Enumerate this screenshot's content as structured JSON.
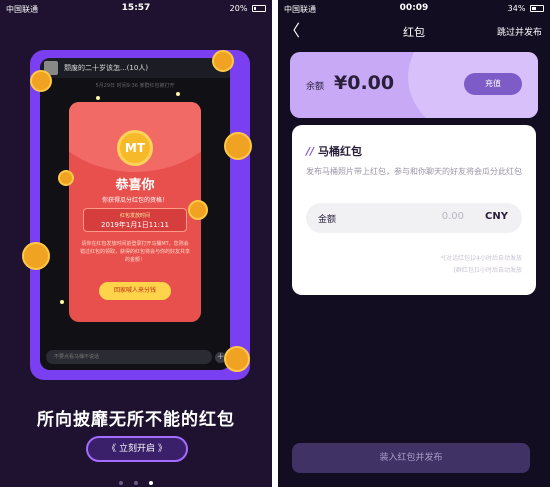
{
  "left": {
    "statusbar": {
      "carrier": "中国联通",
      "time": "15:57",
      "battery": "20%"
    },
    "chat": {
      "title": "颓废的二十岁该怎...(10人)",
      "subtitle": "5月29日 时间9:36 某群红包被打开"
    },
    "redpacket": {
      "coin_text": "MT",
      "title": "恭喜你",
      "subtitle": "你获得瓜分红包的资格！",
      "time_label": "红包发放时间",
      "time_value": "2019年1月1日11:11",
      "description": "请你在红包发放时间前登录打开马桶MT，您则会错过红包的领取，获得的红包将会与你的好友共享的金额！",
      "button": "回家喊人来分钱"
    },
    "chat_input_placeholder": "不要点看马桶不说话",
    "slogan": "所向披靡无所不能的红包",
    "open_button": "《 立刻开启 》",
    "page_count": 3,
    "active_page": 3
  },
  "right": {
    "statusbar": {
      "carrier": "中国联通",
      "time": "00:09",
      "battery": "34%"
    },
    "nav": {
      "back": "〈",
      "title": "红包",
      "skip": "跳过并发布"
    },
    "balance": {
      "label": "余额",
      "amount": "¥0.00",
      "recharge": "充值"
    },
    "form": {
      "title_mark": "//",
      "title": "马桶红包",
      "description": "发布马桶照片带上红包，参与和你聊天的好友将会瓜分此红包",
      "amount_label": "金额",
      "amount_value": "0.00",
      "currency": "CNY",
      "note1": "*[对话红包]24小时后自动发放",
      "note2": "[群红包]1小时后自动发放"
    },
    "submit": "装入红包并发布"
  }
}
